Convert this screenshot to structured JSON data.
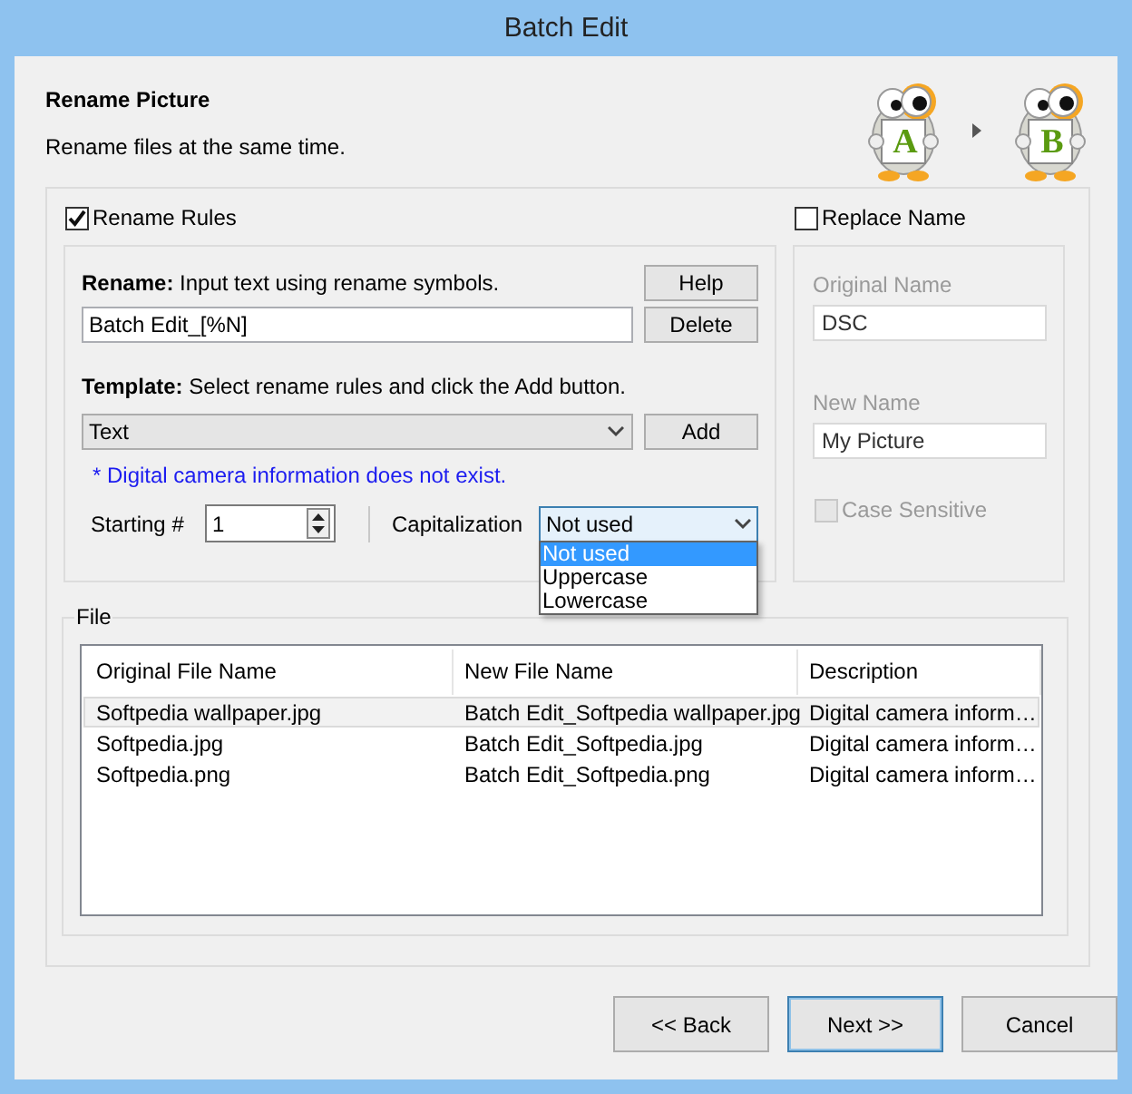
{
  "window": {
    "title": "Batch Edit"
  },
  "header": {
    "title": "Rename Picture",
    "subtitle": "Rename files at the same time.",
    "mascots": [
      {
        "letter": "A"
      },
      {
        "letter": "B"
      }
    ]
  },
  "rename_rules": {
    "label": "Rename Rules",
    "checked": true,
    "rename": {
      "label": "Rename:",
      "hint": "Input text using rename symbols.",
      "value": "Batch Edit_[%N]"
    },
    "help_button": "Help",
    "delete_button": "Delete",
    "template": {
      "label": "Template:",
      "hint": "Select rename rules and click the Add button.",
      "value": "Text"
    },
    "add_button": "Add",
    "note": "* Digital camera information does not exist.",
    "starting": {
      "label": "Starting #",
      "value": "1"
    },
    "capitalization": {
      "label": "Capitalization",
      "value": "Not used",
      "expanded": true,
      "options": [
        {
          "label": "Not used",
          "selected": true
        },
        {
          "label": "Uppercase",
          "selected": false
        },
        {
          "label": "Lowercase",
          "selected": false
        }
      ]
    }
  },
  "replace_name": {
    "label": "Replace Name",
    "checked": false,
    "original_label": "Original Name",
    "original_value": "DSC",
    "new_label": "New Name",
    "new_value": "My Picture",
    "case_sensitive": {
      "label": "Case Sensitive",
      "checked": false
    }
  },
  "file": {
    "title": "File",
    "columns": [
      "Original File Name",
      "New File Name",
      "Description"
    ],
    "rows": [
      {
        "cells": [
          "Softpedia wallpaper.jpg",
          "Batch Edit_Softpedia wallpaper.jpg",
          "Digital camera inform…"
        ],
        "selected": true
      },
      {
        "cells": [
          "Softpedia.jpg",
          "Batch Edit_Softpedia.jpg",
          "Digital camera inform…"
        ],
        "selected": false
      },
      {
        "cells": [
          "Softpedia.png",
          "Batch Edit_Softpedia.png",
          "Digital camera inform…"
        ],
        "selected": false
      }
    ]
  },
  "buttons": [
    {
      "label": "<< Back",
      "default": false
    },
    {
      "label": "Next >>",
      "default": true
    },
    {
      "label": "Cancel",
      "default": false
    }
  ]
}
